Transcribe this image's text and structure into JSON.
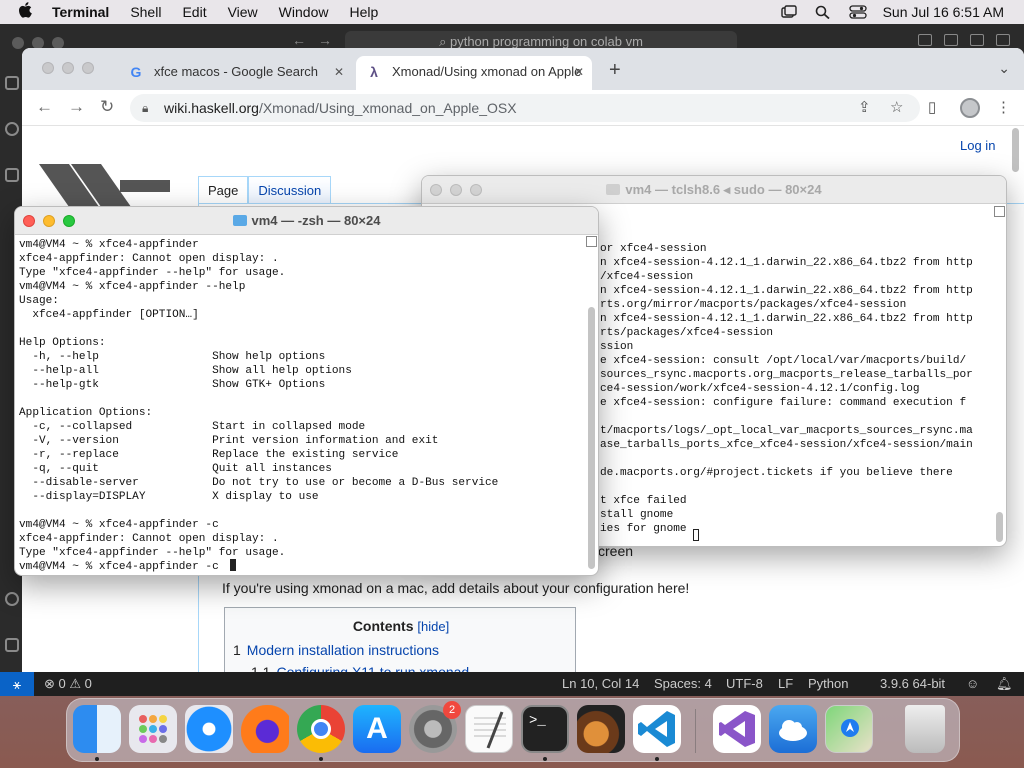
{
  "menubar": {
    "apple_icon": "apple-logo",
    "app_name": "Terminal",
    "items": [
      "Shell",
      "Edit",
      "View",
      "Window",
      "Help"
    ],
    "datetime": "Sun Jul 16  6:51 AM"
  },
  "vscode": {
    "search_placeholder": "python programming on colab vm",
    "status": {
      "problems": "⊗ 0 ⚠ 0",
      "position": "Ln 10, Col 14",
      "spaces": "Spaces: 4",
      "encoding": "UTF-8",
      "eol": "LF",
      "language": "Python",
      "interpreter": "3.9.6 64-bit"
    }
  },
  "browser": {
    "tabs": [
      {
        "label": "xfce macos - Google Search",
        "favicon": "G"
      },
      {
        "label": "Xmonad/Using xmonad on Apple",
        "favicon": "λ"
      }
    ],
    "url_host": "wiki.haskell.org",
    "url_path": "/Xmonad/Using_xmonad_on_Apple_OSX"
  },
  "wiki": {
    "tab_page": "Page",
    "tab_discussion": "Discussion",
    "login": "Log in",
    "screen_word": "creen",
    "paragraph": "If you're using xmonad on a mac, add details about your configuration here!",
    "toc_title": "Contents",
    "toc_hide": "[hide]",
    "toc_item1_num": "1",
    "toc_item1": "Modern installation instructions",
    "toc_item2_num": "1.1",
    "toc_item2": "Configuring X11 to run xmonad"
  },
  "terminal_front": {
    "title": "vm4 — -zsh — 80×24",
    "lines": "vm4@VM4 ~ % xfce4-appfinder\nxfce4-appfinder: Cannot open display: .\nType \"xfce4-appfinder --help\" for usage.\nvm4@VM4 ~ % xfce4-appfinder --help\nUsage:\n  xfce4-appfinder [OPTION…]\n\nHelp Options:\n  -h, --help                 Show help options\n  --help-all                 Show all help options\n  --help-gtk                 Show GTK+ Options\n\nApplication Options:\n  -c, --collapsed            Start in collapsed mode\n  -V, --version              Print version information and exit\n  -r, --replace              Replace the existing service\n  -q, --quit                 Quit all instances\n  --disable-server           Do not try to use or become a D-Bus service\n  --display=DISPLAY          X display to use\n\nvm4@VM4 ~ % xfce4-appfinder -c\nxfce4-appfinder: Cannot open display: .\nType \"xfce4-appfinder --help\" for usage.\nvm4@VM4 ~ % xfce4-appfinder -c"
  },
  "terminal_back": {
    "title": "vm4 — tclsh8.6 ◂ sudo — 80×24",
    "lines": "\n\nor xfce4-session\nn xfce4-session-4.12.1_1.darwin_22.x86_64.tbz2 from http\n/xfce4-session\nn xfce4-session-4.12.1_1.darwin_22.x86_64.tbz2 from http\nrts.org/mirror/macports/packages/xfce4-session\nn xfce4-session-4.12.1_1.darwin_22.x86_64.tbz2 from http\nrts/packages/xfce4-session\nssion\ne xfce4-session: consult /opt/local/var/macports/build/\nsources_rsync.macports.org_macports_release_tarballs_por\nce4-session/work/xfce4-session-4.12.1/config.log\ne xfce4-session: configure failure: command execution f\n\nt/macports/logs/_opt_local_var_macports_sources_rsync.ma\nase_tarballs_ports_xfce_xfce4-session/xfce4-session/main\n\nde.macports.org/#project.tickets if you believe there\n\nt xfce failed\nstall gnome\nies for gnome"
  },
  "dock": {
    "items": [
      "Finder",
      "Launchpad",
      "Safari",
      "Firefox",
      "Chrome",
      "App Store",
      "System Settings",
      "TextEdit",
      "Terminal",
      "GarageBand",
      "Visual Studio Code",
      "Visual Studio",
      "iCloud",
      "Maps",
      "Trash"
    ],
    "settings_badge": "2"
  }
}
